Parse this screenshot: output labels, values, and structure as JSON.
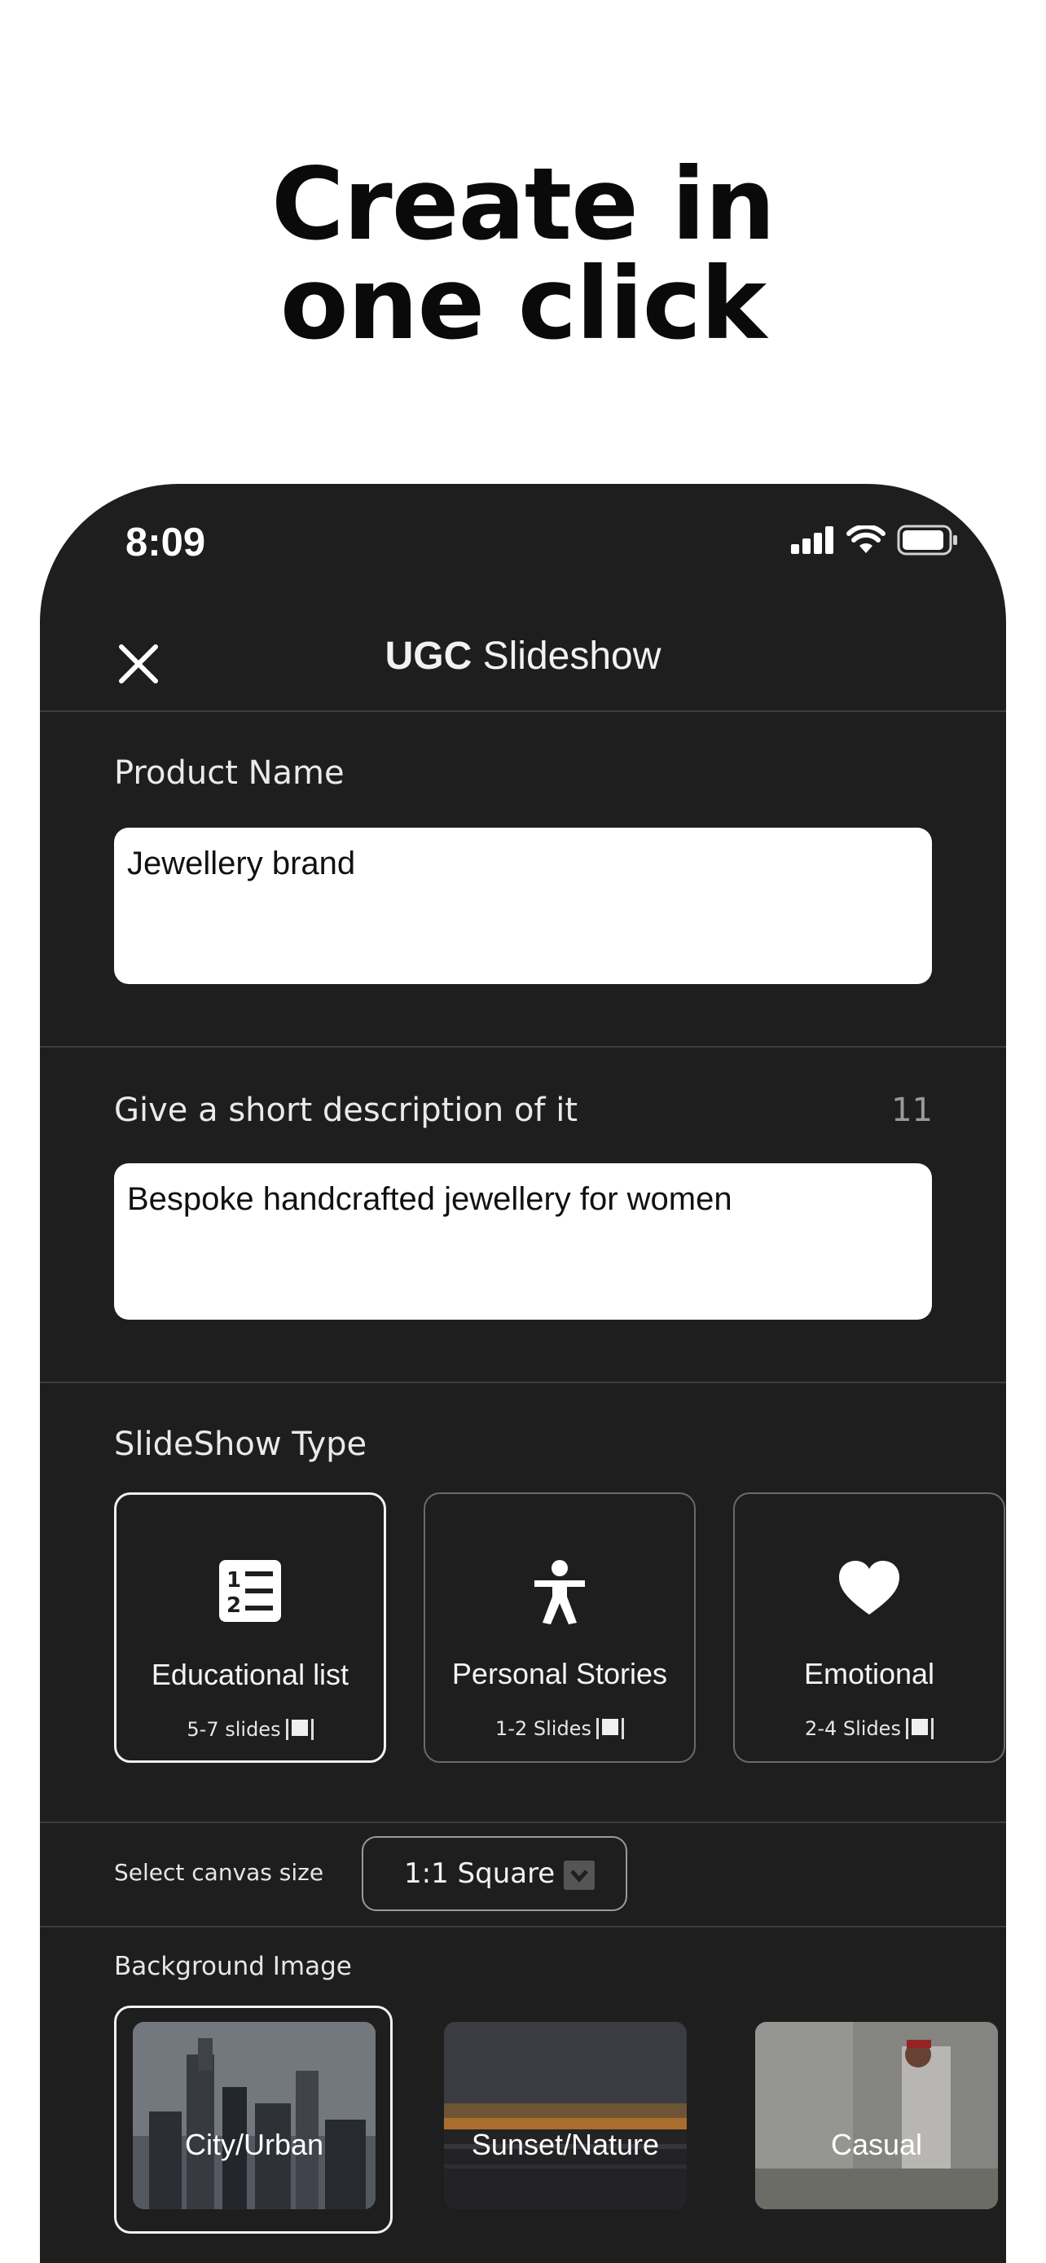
{
  "headline": {
    "line1": "Create in",
    "line2": "one click"
  },
  "status_bar": {
    "time": "8:09"
  },
  "navbar": {
    "title_bold": "UGC",
    "title_rest": " Slideshow"
  },
  "product_name": {
    "label": "Product Name",
    "value": "Jewellery brand"
  },
  "description": {
    "label": "Give a short description of it",
    "counter": "11",
    "value": "Bespoke handcrafted jewellery for women"
  },
  "slideshow_type": {
    "label": "SlideShow Type",
    "options": [
      {
        "title": "Educational list",
        "subtitle": "5-7 slides",
        "icon": "numbered-list-icon",
        "selected": true
      },
      {
        "title": "Personal Stories",
        "subtitle": "1-2 Slides",
        "icon": "person-icon",
        "selected": false
      },
      {
        "title": "Emotional",
        "subtitle": "2-4 Slides",
        "icon": "heart-icon",
        "selected": false
      }
    ]
  },
  "canvas": {
    "label": "Select canvas size",
    "selected": "1:1 Square"
  },
  "background": {
    "label": "Background Image",
    "options": [
      {
        "title": "City/Urban",
        "selected": true
      },
      {
        "title": "Sunset/Nature",
        "selected": false
      },
      {
        "title": "Casual",
        "selected": false
      }
    ]
  },
  "colors": {
    "panel": "#1e1e1e",
    "divider": "#3d3d3d",
    "text": "#ffffff",
    "field": "#ffffff"
  }
}
